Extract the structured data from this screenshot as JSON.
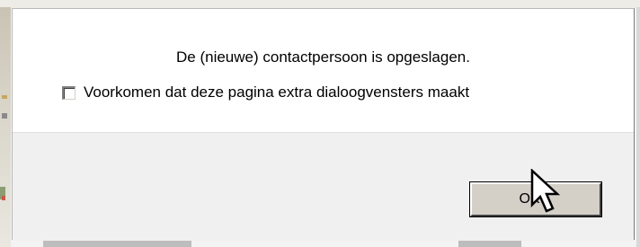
{
  "dialog": {
    "message": "De (nieuwe) contactpersoon is opgeslagen.",
    "suppress_checkbox": {
      "label": "Voorkomen dat deze pagina extra dialoogvensters maakt",
      "checked": false
    },
    "ok_label": "OK"
  },
  "cursor": {
    "icon": "arrow-pointer-icon"
  },
  "colors": {
    "dialog_body": "#ffffff",
    "dialog_footer": "#f0f0f0",
    "button_face": "#d4d0c8"
  }
}
